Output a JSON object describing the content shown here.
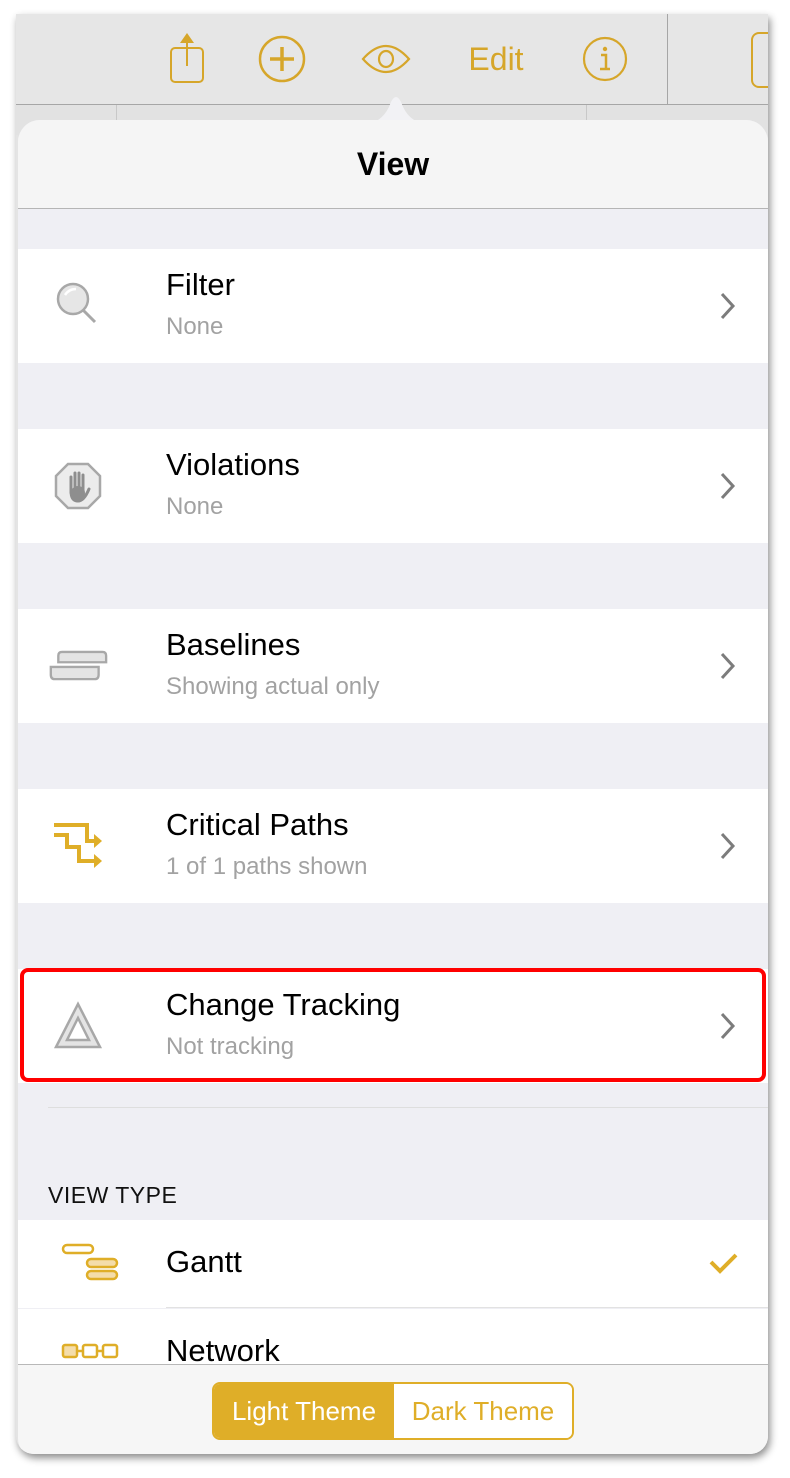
{
  "toolbar": {
    "buttons": [
      {
        "name": "share",
        "icon": "share-icon"
      },
      {
        "name": "add",
        "icon": "plus-circle-icon"
      },
      {
        "name": "view",
        "icon": "eye-icon"
      },
      {
        "name": "edit",
        "label": "Edit"
      },
      {
        "name": "info",
        "icon": "info-circle-icon"
      }
    ],
    "accent_color": "#d6a62a"
  },
  "popover": {
    "title": "View",
    "rows": [
      {
        "title": "Filter",
        "subtitle": "None",
        "icon": "magnifier-icon"
      },
      {
        "title": "Violations",
        "subtitle": "None",
        "icon": "stop-hand-icon"
      },
      {
        "title": "Baselines",
        "subtitle": "Showing actual only",
        "icon": "baselines-icon"
      },
      {
        "title": "Critical Paths",
        "subtitle": "1 of 1 paths shown",
        "icon": "critical-paths-icon"
      },
      {
        "title": "Change Tracking",
        "subtitle": "Not tracking",
        "icon": "triangle-icon",
        "highlighted": true
      }
    ],
    "view_type": {
      "label": "VIEW TYPE",
      "items": [
        {
          "title": "Gantt",
          "icon": "gantt-icon",
          "selected": true
        },
        {
          "title": "Network",
          "icon": "network-icon",
          "selected": false
        }
      ]
    },
    "theme": {
      "options": [
        "Light Theme",
        "Dark Theme"
      ],
      "selected": "Light Theme"
    }
  },
  "colors": {
    "accent": "#dfae28",
    "highlight_border": "#ff0000"
  }
}
